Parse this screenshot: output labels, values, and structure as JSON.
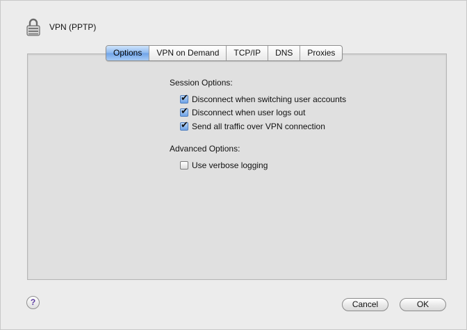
{
  "header": {
    "title": "VPN (PPTP)",
    "icon": "lock-icon"
  },
  "tabs": [
    {
      "label": "Options",
      "active": true
    },
    {
      "label": "VPN on Demand",
      "active": false
    },
    {
      "label": "TCP/IP",
      "active": false
    },
    {
      "label": "DNS",
      "active": false
    },
    {
      "label": "Proxies",
      "active": false
    }
  ],
  "session": {
    "heading": "Session Options:",
    "options": [
      {
        "label": "Disconnect when switching user accounts",
        "checked": true
      },
      {
        "label": "Disconnect when user logs out",
        "checked": true
      },
      {
        "label": "Send all traffic over VPN connection",
        "checked": true
      }
    ]
  },
  "advanced": {
    "heading": "Advanced Options:",
    "options": [
      {
        "label": "Use verbose logging",
        "checked": false
      }
    ]
  },
  "footer": {
    "help_label": "?",
    "cancel_label": "Cancel",
    "ok_label": "OK"
  },
  "colors": {
    "accent": "#6fa3e8",
    "panel": "#e0e0e0",
    "window": "#ececec"
  }
}
